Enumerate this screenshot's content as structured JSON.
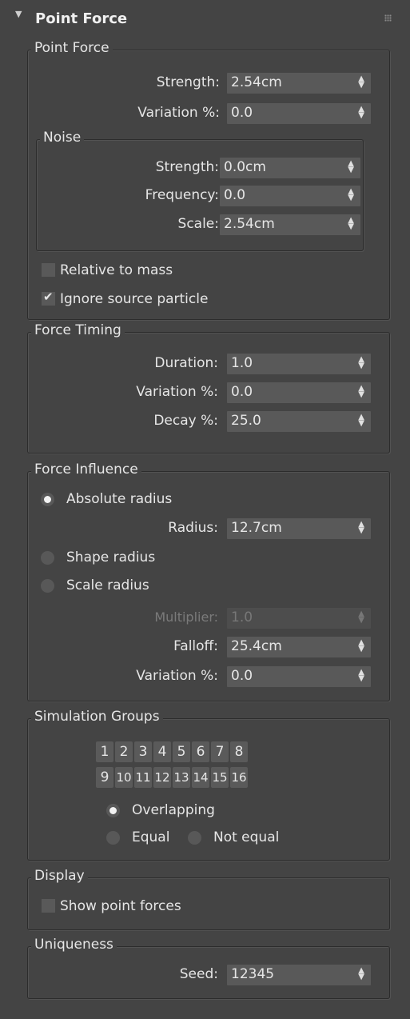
{
  "rollout": {
    "title": "Point Force"
  },
  "point_force": {
    "group_label": "Point Force",
    "strength": {
      "label": "Strength:",
      "value": "2.54cm"
    },
    "variation": {
      "label": "Variation %:",
      "value": "0.0"
    },
    "noise": {
      "group_label": "Noise",
      "strength": {
        "label": "Strength:",
        "value": "0.0cm"
      },
      "frequency": {
        "label": "Frequency:",
        "value": "0.0"
      },
      "scale": {
        "label": "Scale:",
        "value": "2.54cm"
      }
    },
    "relative_to_mass": {
      "label": "Relative to mass",
      "checked": false
    },
    "ignore_source_particle": {
      "label": "Ignore source particle",
      "checked": true
    }
  },
  "force_timing": {
    "group_label": "Force Timing",
    "duration": {
      "label": "Duration:",
      "value": "1.0"
    },
    "variation": {
      "label": "Variation %:",
      "value": "0.0"
    },
    "decay": {
      "label": "Decay %:",
      "value": "25.0"
    }
  },
  "force_influence": {
    "group_label": "Force Influence",
    "absolute_radius": {
      "label": "Absolute radius",
      "selected": true
    },
    "radius": {
      "label": "Radius:",
      "value": "12.7cm"
    },
    "shape_radius": {
      "label": "Shape radius",
      "selected": false
    },
    "scale_radius": {
      "label": "Scale radius",
      "selected": false
    },
    "multiplier": {
      "label": "Multiplier:",
      "value": "1.0"
    },
    "falloff": {
      "label": "Falloff:",
      "value": "25.4cm"
    },
    "variation": {
      "label": "Variation %:",
      "value": "0.0"
    }
  },
  "simulation_groups": {
    "group_label": "Simulation Groups",
    "buttons": [
      "1",
      "2",
      "3",
      "4",
      "5",
      "6",
      "7",
      "8",
      "9",
      "10",
      "11",
      "12",
      "13",
      "14",
      "15",
      "16"
    ],
    "overlapping": {
      "label": "Overlapping",
      "selected": true
    },
    "equal": {
      "label": "Equal",
      "selected": false
    },
    "not_equal": {
      "label": "Not equal",
      "selected": false
    }
  },
  "display": {
    "group_label": "Display",
    "show_point_forces": {
      "label": "Show point forces",
      "checked": false
    }
  },
  "uniqueness": {
    "group_label": "Uniqueness",
    "seed": {
      "label": "Seed:",
      "value": "12345"
    }
  },
  "icons": {
    "collapse": "triangle-down-icon",
    "spinner": "updown-arrows-icon",
    "grip": "grip-dots-icon",
    "check": "checkmark-icon"
  }
}
